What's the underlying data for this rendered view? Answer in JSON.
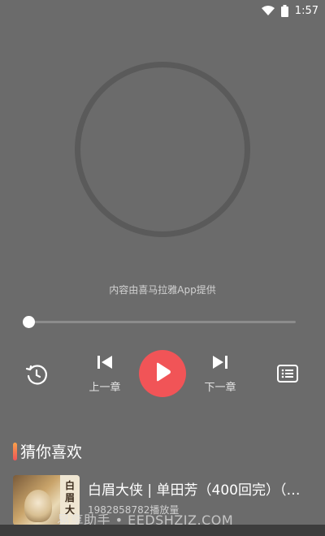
{
  "status": {
    "time": "1:57",
    "icons": [
      "wifi-icon",
      "battery-icon"
    ]
  },
  "player": {
    "provider_text": "内容由喜马拉雅App提供",
    "progress": 0,
    "prev_label": "上一章",
    "next_label": "下一章",
    "icons": [
      "history-icon",
      "skip-previous-icon",
      "play-icon",
      "skip-next-icon",
      "playlist-icon"
    ]
  },
  "recommend": {
    "title": "猜你喜欢",
    "items": [
      {
        "name": "白眉大侠 | 单田芳（400回完）（…",
        "plays": "1982858782播放量",
        "cover_text": [
          "白",
          "眉",
          "大"
        ]
      }
    ]
  },
  "watermark": "易享助手 • EEDSHZJZ.COM",
  "colors": {
    "background": "#6b6b6b",
    "accent": "#f15457"
  }
}
